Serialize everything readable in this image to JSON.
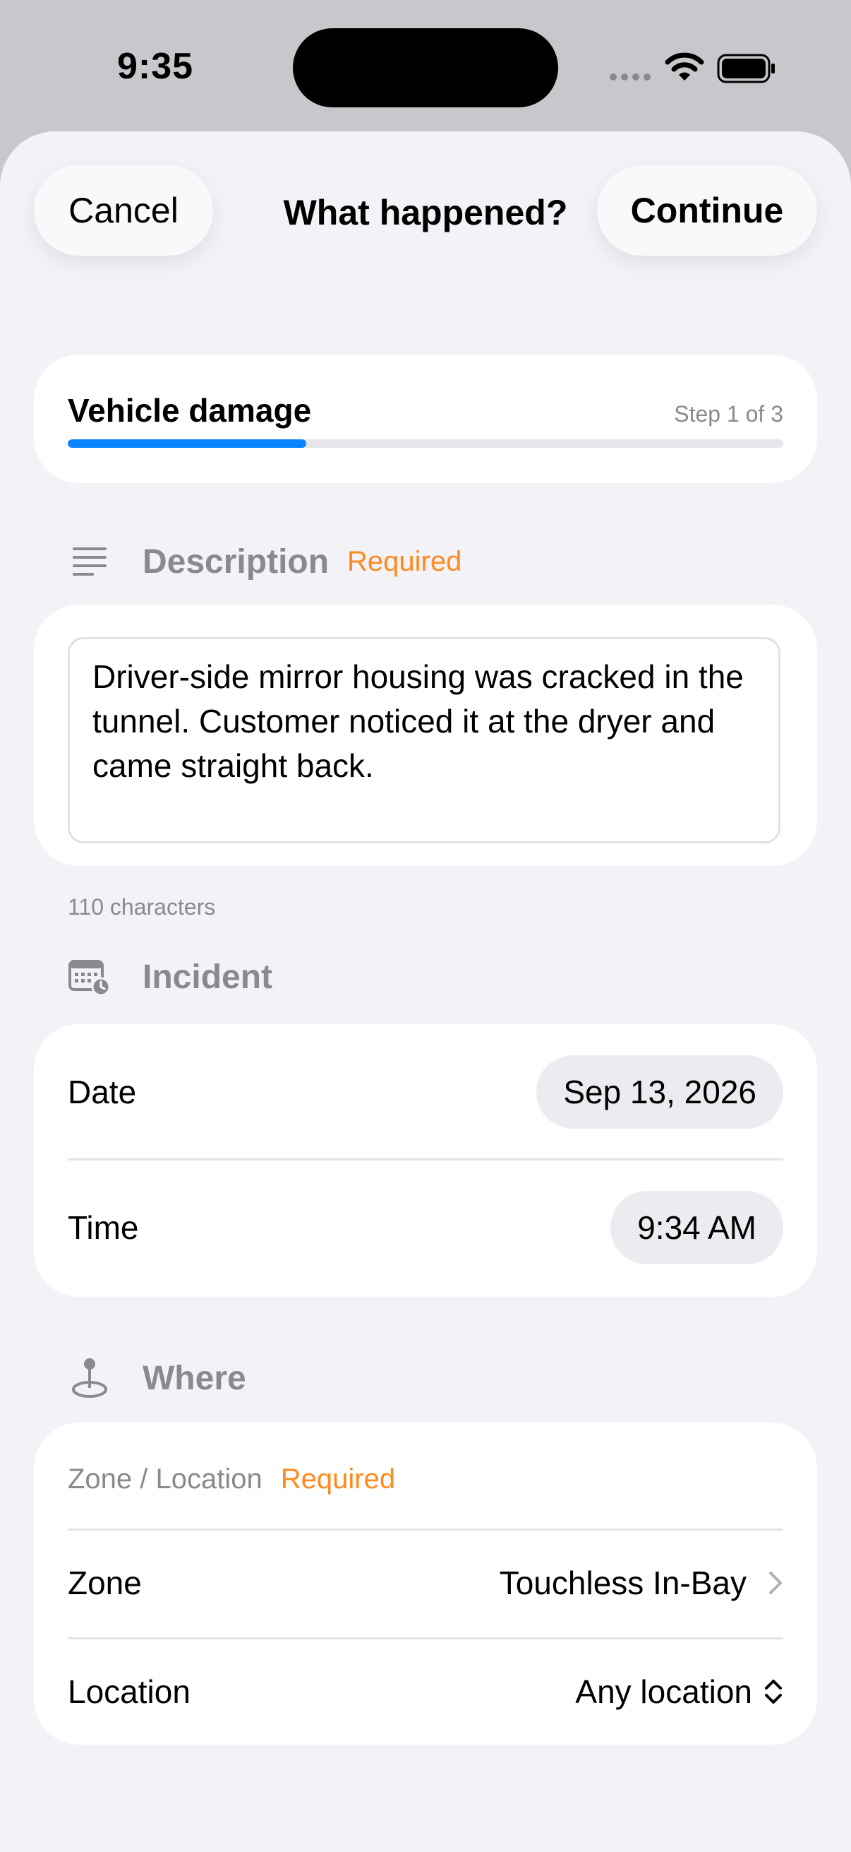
{
  "status_bar": {
    "time": "9:35"
  },
  "nav": {
    "cancel_label": "Cancel",
    "title": "What happened?",
    "continue_label": "Continue"
  },
  "step": {
    "title": "Vehicle damage",
    "count": "Step 1 of 3",
    "progress": 0.333
  },
  "description": {
    "section_title": "Description",
    "required": "Required",
    "text": "Driver-side mirror housing was cracked in the tunnel. Customer noticed it at the dryer and came straight back.",
    "char_count": "110 characters"
  },
  "incident": {
    "section_title": "Incident",
    "date_label": "Date",
    "date_value": "Sep 13, 2026",
    "time_label": "Time",
    "time_value": "9:34 AM"
  },
  "where": {
    "section_title": "Where",
    "zone_location_label": "Zone / Location",
    "required": "Required",
    "zone_label": "Zone",
    "zone_value": "Touchless In-Bay",
    "location_label": "Location",
    "location_value": "Any location"
  },
  "colors": {
    "accent": "#0a84ff",
    "required": "#ff8a1f",
    "background": "#f2f2f7"
  },
  "icons": [
    "wifi-icon",
    "battery-icon",
    "text-align-icon",
    "calendar-clock-icon",
    "map-pin-icon",
    "chevron-right-icon",
    "chevron-up-down-icon"
  ]
}
